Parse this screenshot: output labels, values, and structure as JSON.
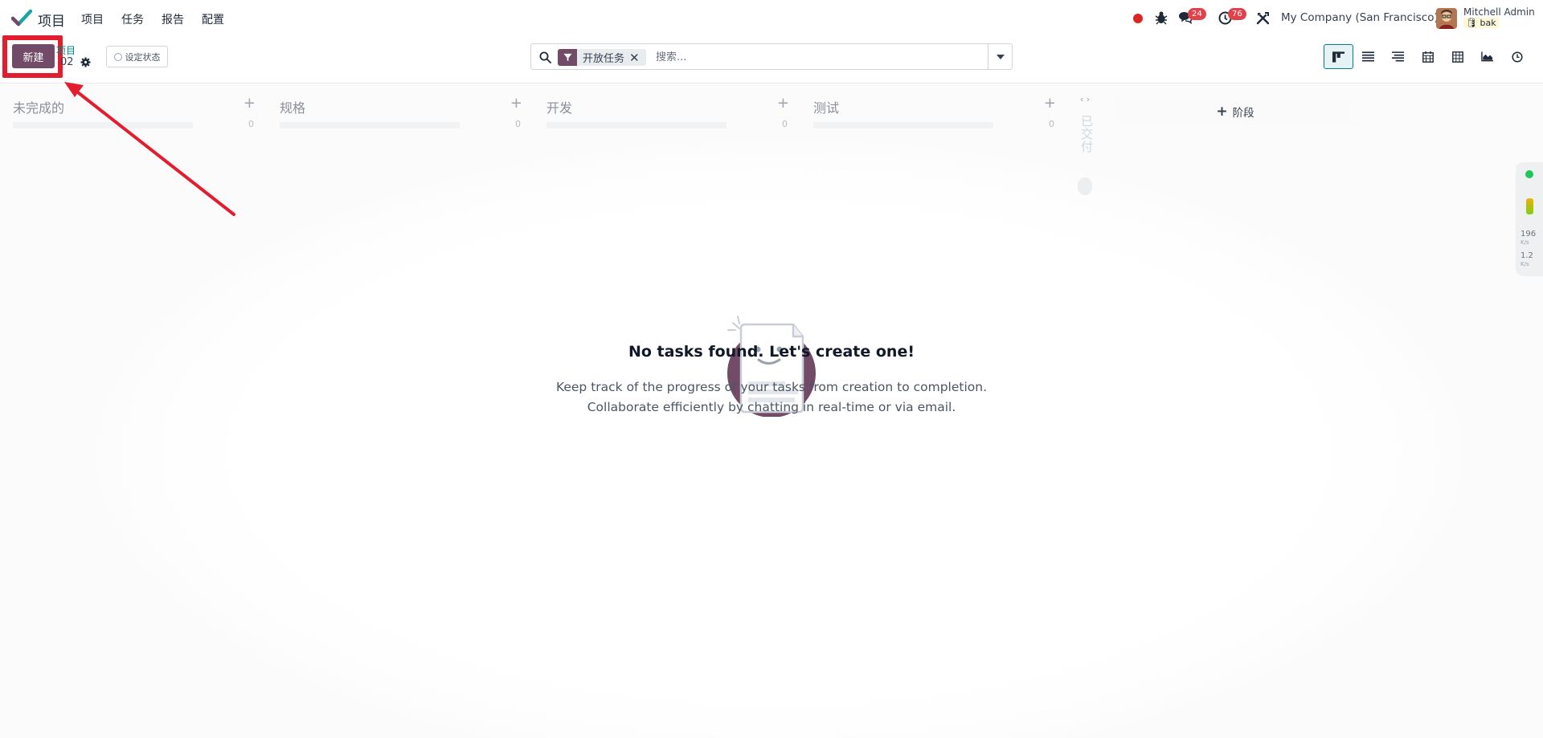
{
  "app": {
    "name": "项目"
  },
  "menu": [
    {
      "label": "项目"
    },
    {
      "label": "任务"
    },
    {
      "label": "报告"
    },
    {
      "label": "配置"
    }
  ],
  "systray": {
    "chat_count": "24",
    "activity_count": "76",
    "company": "My Company (San Francisco)",
    "user_name": "Mitchell Admin",
    "database": "bak"
  },
  "control_panel": {
    "new_label": "新建",
    "breadcrumb": "项目",
    "record_sub": "02",
    "status_label": "设定状态",
    "search": {
      "facet_label": "开放任务",
      "facet_close": "✕",
      "placeholder": "搜索..."
    }
  },
  "columns": [
    {
      "title": "未完成的",
      "count": "0"
    },
    {
      "title": "规格",
      "count": "0"
    },
    {
      "title": "开发",
      "count": "0"
    },
    {
      "title": "测试",
      "count": "0"
    }
  ],
  "folded_column": {
    "title": "已交付"
  },
  "add_stage": {
    "label": "阶段"
  },
  "empty_state": {
    "title": "No tasks found. Let's create one!",
    "line1": "Keep track of the progress of your tasks from creation to completion.",
    "line2": "Collaborate efficiently by chatting in real-time or via email."
  },
  "side_widget": {
    "up_value": "196",
    "down_value": "1.2",
    "unit": "K/s"
  },
  "colors": {
    "brand": "#714b67",
    "accent": "#017e84",
    "annotation": "#e11d2e"
  }
}
